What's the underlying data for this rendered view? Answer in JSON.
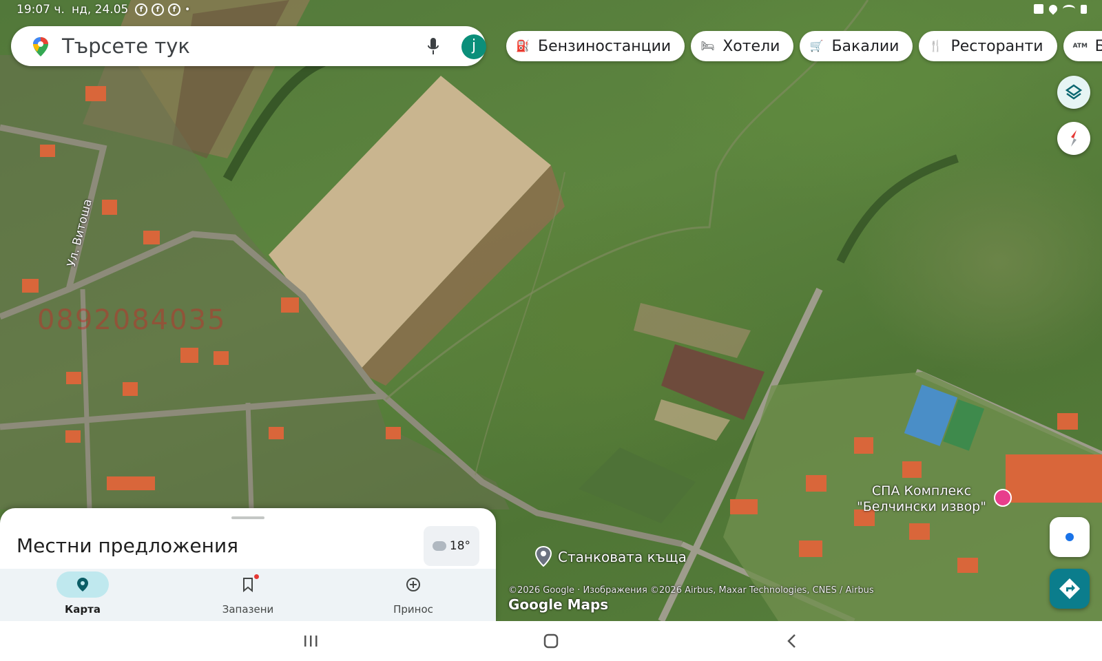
{
  "status_bar": {
    "time": "19:07 ч.",
    "date": "нд, 24.05",
    "notification_icons": [
      "facebook-icon",
      "facebook-icon",
      "facebook-icon",
      "dot-icon"
    ],
    "system_icons": [
      "alarm-icon",
      "location-icon",
      "wifi-icon",
      "battery-icon"
    ]
  },
  "search": {
    "placeholder": "Търсете тук",
    "avatar_letter": "j",
    "avatar_color": "#0b8f7a"
  },
  "chips": [
    {
      "label": "Бензиностанции",
      "icon": "gas-station-icon"
    },
    {
      "label": "Хотели",
      "icon": "bed-icon"
    },
    {
      "label": "Бакалии",
      "icon": "cart-icon"
    },
    {
      "label": "Ресторанти",
      "icon": "fork-knife-icon"
    },
    {
      "label": "Банк",
      "icon": "atm-icon",
      "icon_text": "ATM"
    }
  ],
  "map": {
    "street_label": "Ул. Витоша",
    "watermark": "0892084035",
    "spa_label_line1": "СПА Комплекс",
    "spa_label_line2": "\"Белчински извор\"",
    "place_label": "Станковата къща",
    "copyright": "©2026 Google · Изображения ©2026 Airbus, Maxar Technologies, CNES / Airbus",
    "brand": "Google Maps"
  },
  "sheet": {
    "title": "Местни предложения",
    "temperature": "18°"
  },
  "bottom_nav": [
    {
      "label": "Карта",
      "icon": "map-pin-icon",
      "active": true
    },
    {
      "label": "Запазени",
      "icon": "bookmark-icon",
      "active": false
    },
    {
      "label": "Принос",
      "icon": "add-circle-icon",
      "active": false
    }
  ],
  "colors": {
    "accent_teal": "#0b7d8c",
    "active_pill": "#bfe8ee",
    "spa_pink": "#e83e8c"
  }
}
